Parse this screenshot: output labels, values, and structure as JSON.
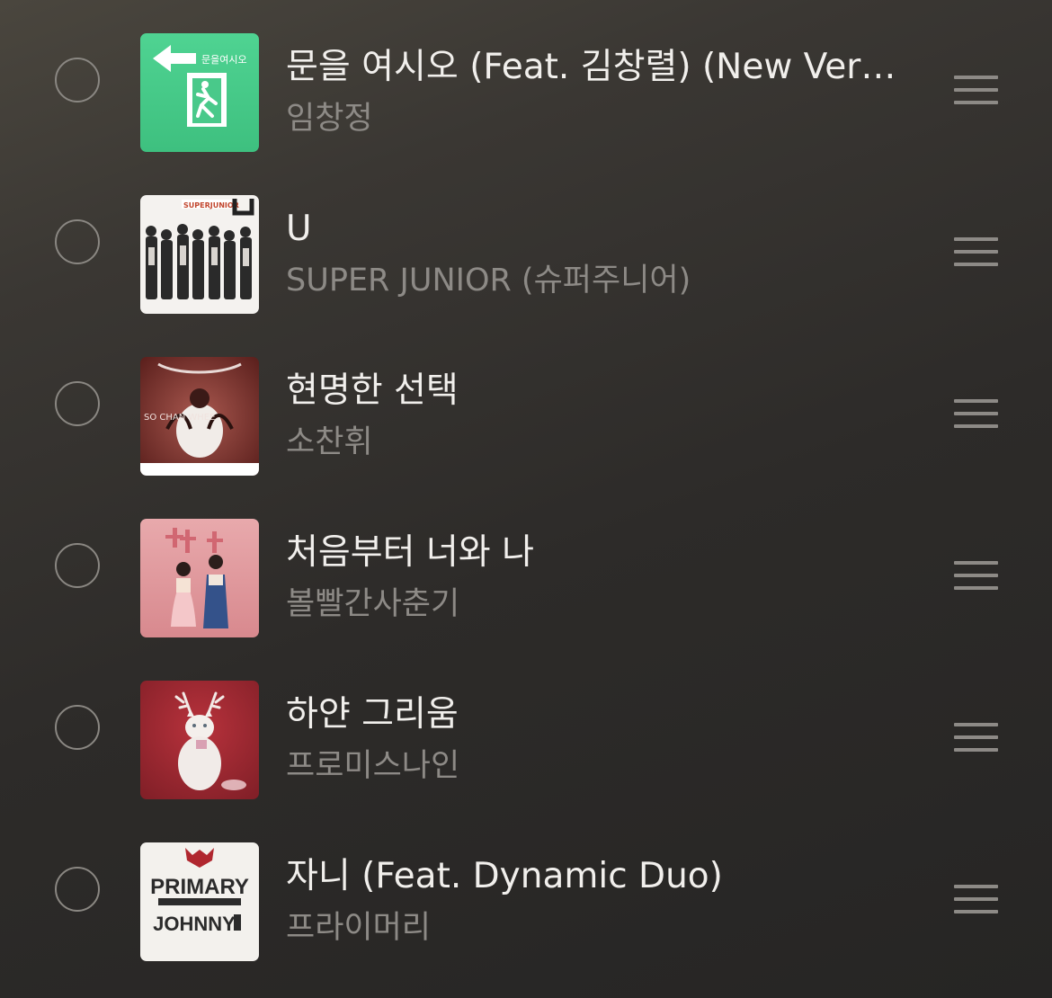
{
  "playlist": {
    "tracks": [
      {
        "title": "문을 여시오 (Feat. 김창렬) (New Version)",
        "artist": "임창정",
        "art_icon": "green-exit-sign-cover",
        "art_text": "문을여시오"
      },
      {
        "title": "U",
        "artist": "SUPER JUNIOR (슈퍼주니어)",
        "art_icon": "group-photo-cover",
        "art_text": "SUPERJUNIOR"
      },
      {
        "title": "현명한 선택",
        "artist": "소찬휘",
        "art_icon": "red-portrait-cover",
        "art_text": "SO CHAN WHEE"
      },
      {
        "title": "처음부터 너와 나",
        "artist": "볼빨간사춘기",
        "art_icon": "hanbok-couple-cover",
        "art_text": ""
      },
      {
        "title": "하얀 그리움",
        "artist": "프로미스나인",
        "art_icon": "white-cat-antlers-cover",
        "art_text": ""
      },
      {
        "title": "자니 (Feat. Dynamic Duo)",
        "artist": "프라이머리",
        "art_icon": "primary-johnny-cover",
        "art_text": "PRIMARY JOHNNY"
      }
    ]
  }
}
